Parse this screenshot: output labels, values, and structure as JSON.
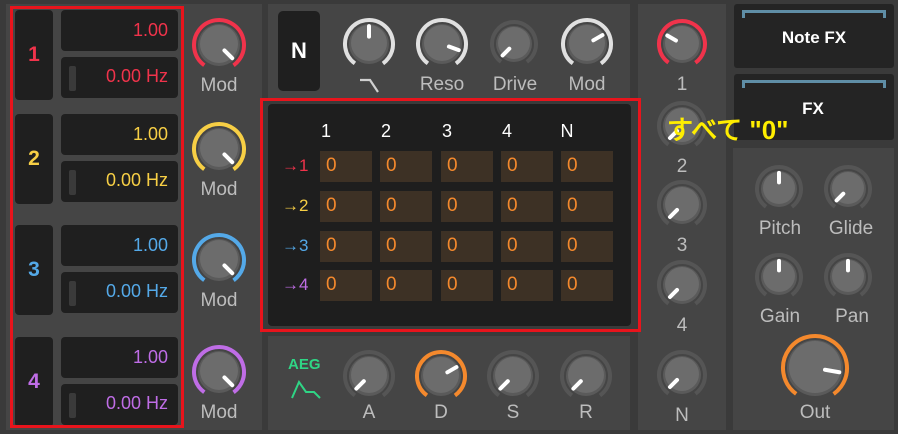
{
  "oscillators": [
    {
      "number": "1",
      "level": "1.00",
      "freq": "0.00 Hz",
      "mod_label": "Mod",
      "color": "#f0334b"
    },
    {
      "number": "2",
      "level": "1.00",
      "freq": "0.00 Hz",
      "mod_label": "Mod",
      "color": "#f7cf45"
    },
    {
      "number": "3",
      "level": "1.00",
      "freq": "0.00 Hz",
      "mod_label": "Mod",
      "color": "#54a9e8"
    },
    {
      "number": "4",
      "level": "1.00",
      "freq": "0.00 Hz",
      "mod_label": "Mod",
      "color": "#bf6de6"
    }
  ],
  "filter": {
    "mode_button": "N",
    "reso_label": "Reso",
    "drive_label": "Drive",
    "mod_label": "Mod"
  },
  "matrix": {
    "columns": [
      "1",
      "2",
      "3",
      "4",
      "N"
    ],
    "rows": [
      {
        "label": "→1",
        "color": "#f0334b",
        "values": [
          "0",
          "0",
          "0",
          "0",
          "0"
        ]
      },
      {
        "label": "→2",
        "color": "#f7cf45",
        "values": [
          "0",
          "0",
          "0",
          "0",
          "0"
        ]
      },
      {
        "label": "→3",
        "color": "#54a9e8",
        "values": [
          "0",
          "0",
          "0",
          "0",
          "0"
        ]
      },
      {
        "label": "→4",
        "color": "#bf6de6",
        "values": [
          "0",
          "0",
          "0",
          "0",
          "0"
        ]
      }
    ]
  },
  "annotation": "すべて \"0\"",
  "envelope": {
    "title": "AEG",
    "labels": [
      "A",
      "D",
      "S",
      "R"
    ]
  },
  "mixer_labels": [
    "1",
    "2",
    "3",
    "4",
    "N"
  ],
  "buttons": {
    "note_fx": "Note FX",
    "fx": "FX"
  },
  "output": {
    "pitch": "Pitch",
    "glide": "Glide",
    "gain": "Gain",
    "pan": "Pan",
    "out": "Out"
  },
  "colors": {
    "accent_orange": "#f4892d",
    "highlight_red": "#e8141c",
    "annotation_yellow": "#ffee00",
    "aeg_green": "#2fd585"
  }
}
